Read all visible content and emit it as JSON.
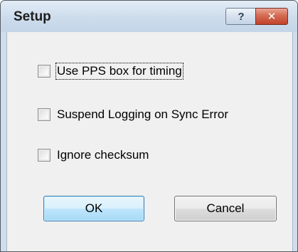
{
  "window": {
    "title": "Setup",
    "help_glyph": "?",
    "close_glyph": "✕"
  },
  "options": [
    {
      "label": "Use PPS box for timing",
      "checked": false,
      "focused": true
    },
    {
      "label": "Suspend Logging on Sync Error",
      "checked": false,
      "focused": false
    },
    {
      "label": "Ignore checksum",
      "checked": false,
      "focused": false
    }
  ],
  "buttons": {
    "ok_label": "OK",
    "cancel_label": "Cancel"
  }
}
